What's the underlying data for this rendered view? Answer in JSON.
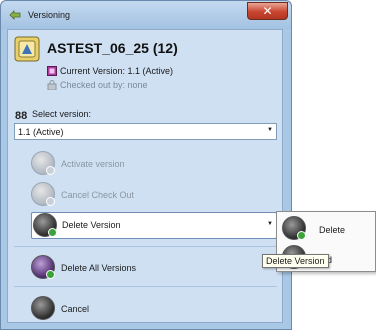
{
  "window": {
    "title": "Versioning",
    "close_glyph": "✕"
  },
  "header": {
    "document_title": "ASTEST_06_25 (12)",
    "current_version": "Current Version: 1.1 (Active)",
    "checked_out_by": "Checked out by: none"
  },
  "select_version": {
    "label": "Select version:",
    "selected": "1.1 (Active)"
  },
  "actions": {
    "activate": "Activate version",
    "cancel_checkout": "Cancel Check Out",
    "delete_version": "Delete Version",
    "delete_all": "Delete All Versions",
    "cancel": "Cancel"
  },
  "popup_menu": {
    "items": [
      {
        "label": "Delete"
      },
      {
        "label": "red"
      }
    ]
  },
  "tooltip": "Delete Version",
  "colors": {
    "window_frame": "#a9c8e6",
    "client_bg": "#cfe0f3",
    "accent_green": "#3aa33a",
    "close_red": "#c8452f"
  },
  "icons": {
    "title": "versioning-icon",
    "document": "document-version-icon",
    "current_version": "current-version-icon",
    "checked_out": "lock-icon",
    "select_version": "versions-icon",
    "activate": "activate-version-icon",
    "cancel_checkout": "cancel-checkout-icon",
    "delete_version": "delete-version-icon",
    "delete_all": "delete-all-versions-icon",
    "cancel": "cancel-icon"
  }
}
